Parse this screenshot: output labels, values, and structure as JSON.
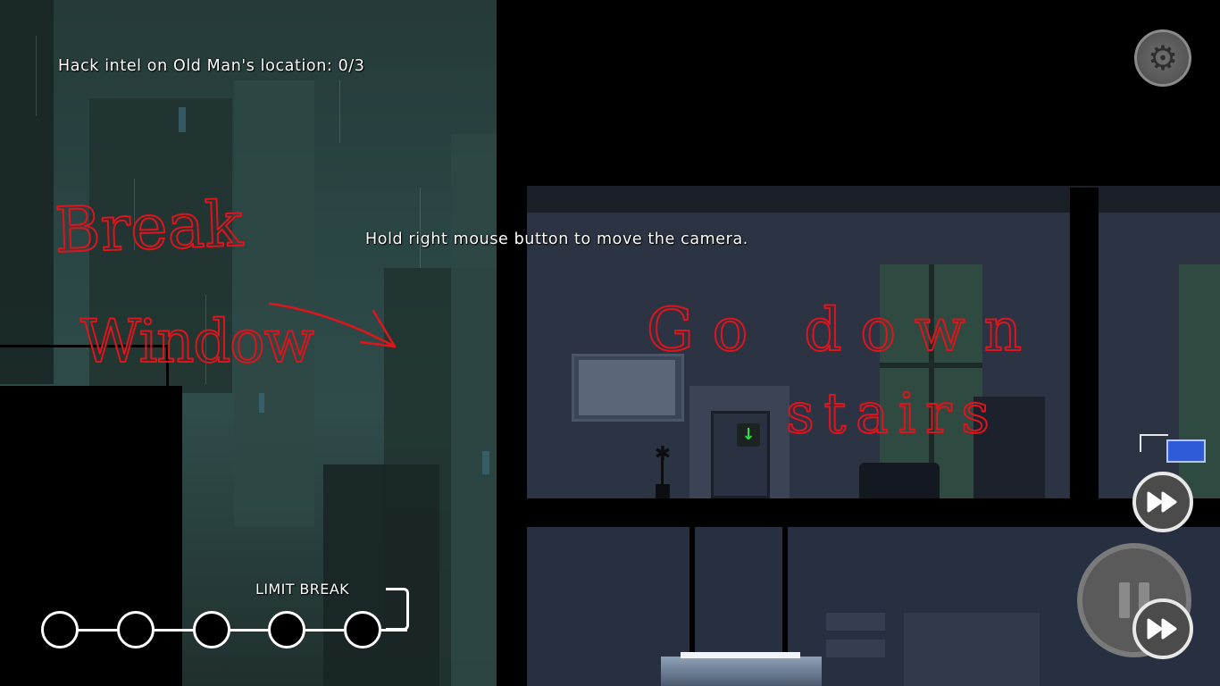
{
  "hud": {
    "objective": "Hack intel on Old Man's location: 0/3",
    "hint": "Hold right mouse button to move the camera.",
    "limit_break_label": "LIMIT BREAK",
    "limit_break_charges": 0,
    "limit_break_slots": 5
  },
  "controls": {
    "settings_icon": "gear-icon",
    "fast_forward_icon": "fast-forward-icon",
    "pause_icon": "pause-icon"
  },
  "annotations": {
    "note_left_line1": "Break",
    "note_left_line2": "Window",
    "note_right_line1": "Go down",
    "note_right_line2": "stairs",
    "ink_color": "#e0141c"
  },
  "scene": {
    "door_indicator_icon": "down-arrow-icon",
    "door_indicator_color": "#28e03c",
    "laptop_color": "#2f5bd8"
  }
}
